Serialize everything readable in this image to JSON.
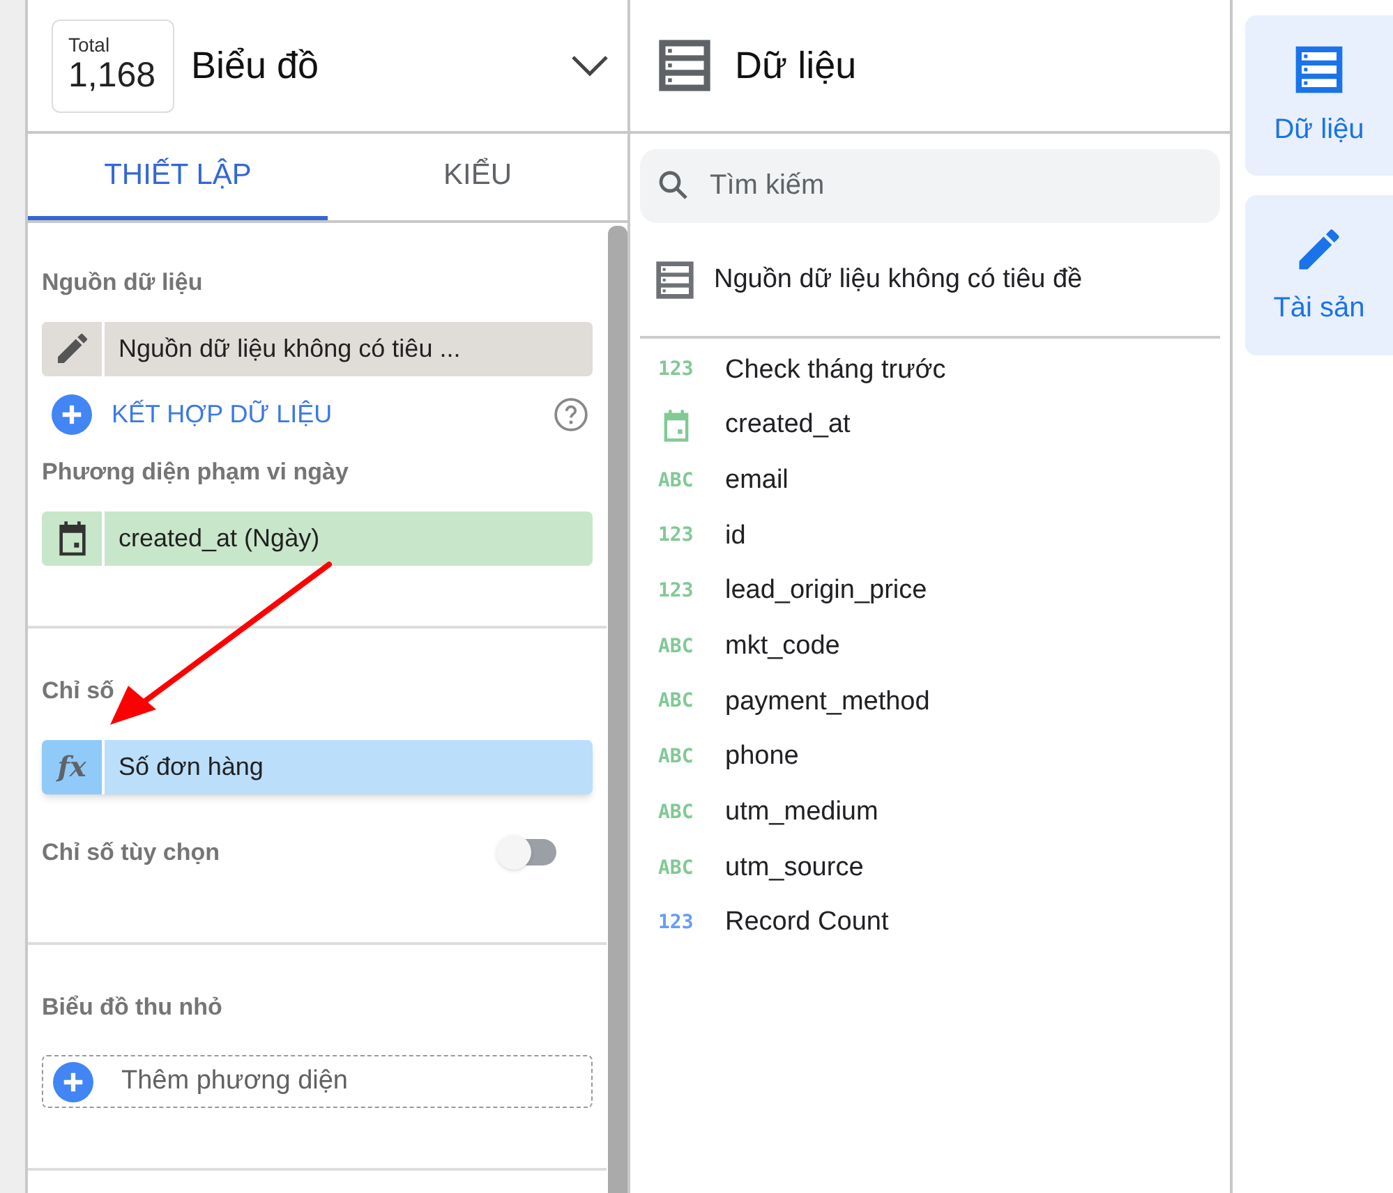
{
  "chart_panel": {
    "total_label": "Total",
    "total_value": "1,168",
    "title": "Biểu đồ",
    "tabs": [
      {
        "label": "THIẾT LẬP",
        "selected": true
      },
      {
        "label": "KIỂU",
        "selected": false
      }
    ],
    "data_source": {
      "label": "Nguồn dữ liệu",
      "chip": {
        "kind": "edit",
        "text": "Nguồn dữ liệu không có tiêu ..."
      },
      "blend_link": "KẾT HỢP DỮ LIỆU"
    },
    "date_dimension": {
      "label": "Phương diện phạm vi ngày",
      "chip": {
        "kind": "date",
        "text": "created_at (Ngày)"
      }
    },
    "metric": {
      "label": "Chỉ số",
      "chip": {
        "kind": "metric",
        "icon_text": "fx",
        "text": "Số đơn hàng"
      }
    },
    "optional_metric": {
      "label": "Chỉ số tùy chọn",
      "on": false
    },
    "sparkline": {
      "label": "Biểu đồ thu nhỏ",
      "add": "Thêm phương diện"
    }
  },
  "data_panel": {
    "title": "Dữ liệu",
    "search": {
      "placeholder": "Tìm kiếm"
    },
    "source": "Nguồn dữ liệu không có tiêu đề",
    "fields": [
      {
        "kind": "number",
        "type_text": "123",
        "name": "Check tháng trước",
        "color": "#81c995"
      },
      {
        "kind": "date",
        "name": "created_at",
        "color": "#81c995"
      },
      {
        "kind": "text",
        "type_text": "ABC",
        "name": "email",
        "color": "#81c995"
      },
      {
        "kind": "number",
        "type_text": "123",
        "name": "id",
        "color": "#81c995"
      },
      {
        "kind": "number",
        "type_text": "123",
        "name": "lead_origin_price",
        "color": "#81c995"
      },
      {
        "kind": "text",
        "type_text": "ABC",
        "name": "mkt_code",
        "color": "#81c995"
      },
      {
        "kind": "text",
        "type_text": "ABC",
        "name": "payment_method",
        "color": "#81c995"
      },
      {
        "kind": "text",
        "type_text": "ABC",
        "name": "phone",
        "color": "#81c995"
      },
      {
        "kind": "text",
        "type_text": "ABC",
        "name": "utm_medium",
        "color": "#81c995"
      },
      {
        "kind": "text",
        "type_text": "ABC",
        "name": "utm_source",
        "color": "#81c995"
      },
      {
        "kind": "number",
        "type_text": "123",
        "name": "Record Count",
        "color": "#669df6"
      }
    ]
  },
  "side_tabs": [
    {
      "kind": "data",
      "label": "Dữ liệu"
    },
    {
      "kind": "assets",
      "label": "Tài sản"
    }
  ]
}
